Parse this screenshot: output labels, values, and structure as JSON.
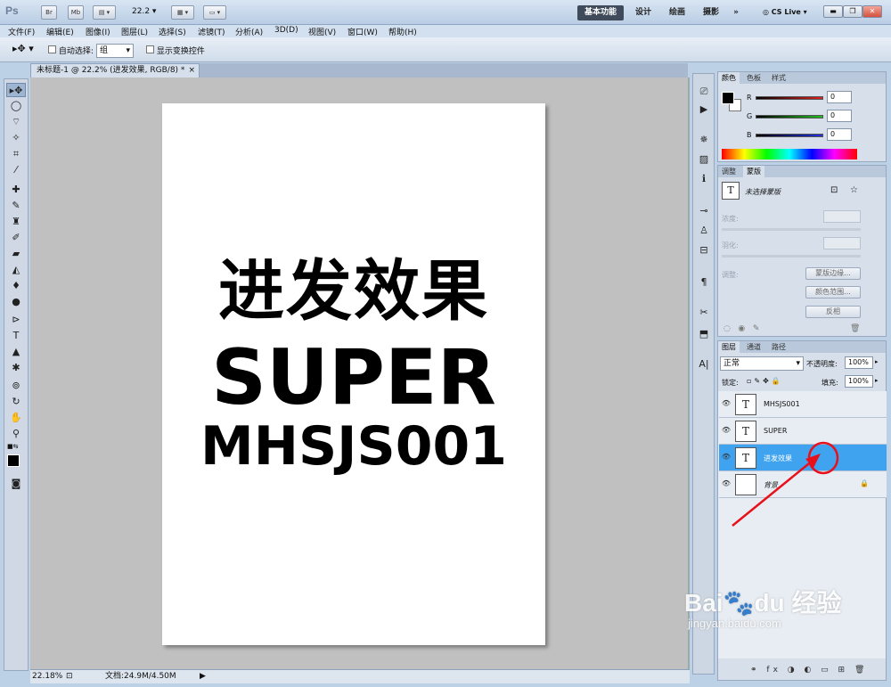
{
  "app": {
    "logo": "Ps",
    "bridge": "Br",
    "minibridge": "Mb",
    "zoom": "22.2"
  },
  "workspaces": [
    {
      "label": "基本功能",
      "active": true
    },
    {
      "label": "设计",
      "active": false
    },
    {
      "label": "绘画",
      "active": false
    },
    {
      "label": "摄影",
      "active": false
    }
  ],
  "more": "»",
  "cslive": "CS Live",
  "menu": [
    "文件(F)",
    "编辑(E)",
    "图像(I)",
    "图层(L)",
    "选择(S)",
    "滤镜(T)",
    "分析(A)",
    "3D(D)",
    "视图(V)",
    "窗口(W)",
    "帮助(H)"
  ],
  "options": {
    "auto_select_label": "自动选择:",
    "auto_select_value": "组",
    "show_transform_label": "显示变换控件"
  },
  "document": {
    "tab_title": "未标题-1 @ 22.2% (进发效果, RGB/8) *",
    "line1": "进发效果",
    "line2": "SUPER",
    "line3": "MHSJS001"
  },
  "status": {
    "zoom": "22.18%",
    "doc_info": "文档:24.9M/4.50M"
  },
  "color_panel": {
    "tabs": [
      "颜色",
      "色板",
      "样式"
    ],
    "channels": [
      {
        "label": "R",
        "value": "0",
        "color": "#e02020"
      },
      {
        "label": "G",
        "value": "0",
        "color": "#20c020"
      },
      {
        "label": "B",
        "value": "0",
        "color": "#2030e0"
      }
    ]
  },
  "masks_panel": {
    "tabs": [
      "调整",
      "蒙版"
    ],
    "title": "未选择蒙版",
    "density": "浓度:",
    "feather": "羽化:",
    "refine": "调整:",
    "btn_edge": "蒙版边缘...",
    "btn_range": "颜色范围...",
    "btn_invert": "反相"
  },
  "layers_panel": {
    "tabs": [
      "图层",
      "通道",
      "路径"
    ],
    "blend_mode": "正常",
    "opacity_label": "不透明度:",
    "opacity_value": "100%",
    "lock_label": "锁定:",
    "fill_label": "填充:",
    "fill_value": "100%",
    "layers": [
      {
        "name": "MHSJS001",
        "type": "text",
        "active": false
      },
      {
        "name": "SUPER",
        "type": "text",
        "active": false
      },
      {
        "name": "进发效果",
        "type": "text",
        "active": true
      },
      {
        "name": "背景",
        "type": "background",
        "active": false
      }
    ]
  },
  "watermark": {
    "brand": "Bai",
    "brand2": "du",
    "brand3": "经验",
    "url": "jingyan.baidu.com"
  },
  "colors": {
    "accent": "#3fa3f0",
    "annotation": "#e8101a",
    "canvas_bg": "#c0c0c0"
  }
}
